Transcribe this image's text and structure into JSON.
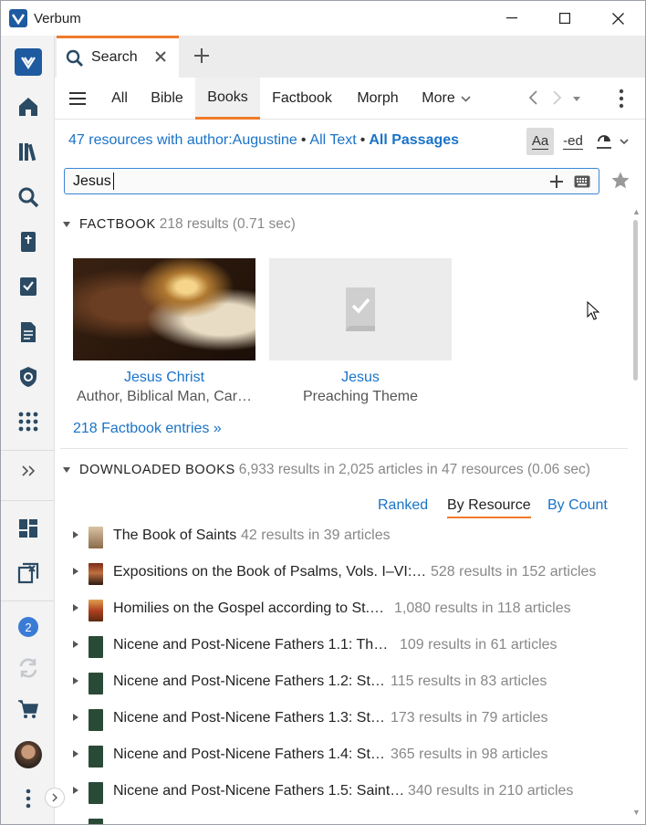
{
  "window": {
    "title": "Verbum"
  },
  "tab": {
    "label": "Search"
  },
  "nav": {
    "tabs": [
      "All",
      "Bible",
      "Books",
      "Factbook",
      "Morph"
    ],
    "more": "More",
    "active": "Books"
  },
  "scope": {
    "resources": "47 resources with author:Augustine",
    "text": "All Text",
    "passages": "All Passages"
  },
  "toolbar": {
    "aa": "Aa",
    "ed": "-ed"
  },
  "search": {
    "value": "Jesus"
  },
  "sidebar": {
    "badge": "2"
  },
  "factbook": {
    "header": "FACTBOOK",
    "count": "218 results (0.71 sec)",
    "cards": [
      {
        "title": "Jesus Christ",
        "subtitle": "Author, Biblical Man, Car…"
      },
      {
        "title": "Jesus",
        "subtitle": "Preaching Theme"
      }
    ],
    "more_link": "218 Factbook entries »"
  },
  "books": {
    "header": "DOWNLOADED BOOKS",
    "count": "6,933 results in 2,025 articles in 47 resources (0.06 sec)",
    "sort": {
      "ranked": "Ranked",
      "by_resource": "By Resource",
      "by_count": "By Count"
    },
    "rows": [
      {
        "title": "The Book of Saints",
        "count": "42 results in 39 articles"
      },
      {
        "title": "Expositions on the Book of Psalms, Vols. I–VI:…",
        "count": "528 results in 152 articles"
      },
      {
        "title": "Homilies on the Gospel according to St.…",
        "count": "1,080 results in 118 articles"
      },
      {
        "title": "Nicene and Post-Nicene Fathers 1.1: The…",
        "count": "109 results in 61 articles"
      },
      {
        "title": "Nicene and Post-Nicene Fathers 1.2: St.…",
        "count": "115 results in 83 articles"
      },
      {
        "title": "Nicene and Post-Nicene Fathers 1.3: St.…",
        "count": "173 results in 79 articles"
      },
      {
        "title": "Nicene and Post-Nicene Fathers 1.4: St.…",
        "count": "365 results in 98 articles"
      },
      {
        "title": "Nicene and Post-Nicene Fathers 1.5: Saint…",
        "count": "340 results in 210 articles"
      }
    ]
  },
  "colors": {
    "accent": "#f07b2a",
    "link": "#1a73c8",
    "brand": "#1e5aa0"
  }
}
